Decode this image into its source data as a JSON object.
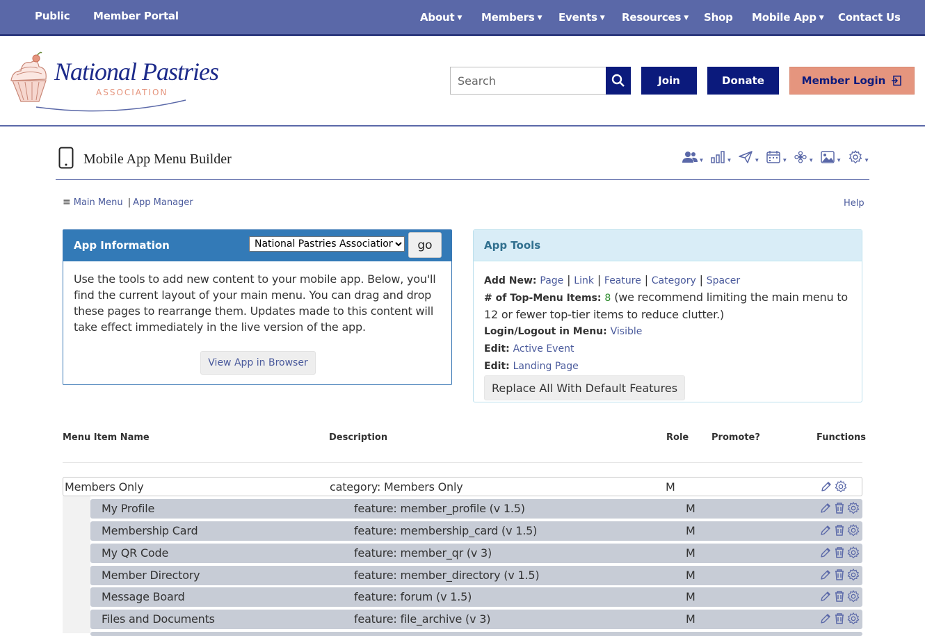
{
  "topnav": {
    "public": "Public",
    "member_portal": "Member Portal",
    "about": "About",
    "members": "Members",
    "events": "Events",
    "resources": "Resources",
    "shop": "Shop",
    "mobile_app": "Mobile App",
    "contact": "Contact Us"
  },
  "header": {
    "logo_line1": "National Pastries",
    "logo_line2": "ASSOCIATION",
    "search_placeholder": "Search",
    "join": "Join",
    "donate": "Donate",
    "login": "Member Login"
  },
  "page": {
    "title": "Mobile App Menu Builder",
    "breadcrumb_main": "Main Menu",
    "breadcrumb_sep": "|",
    "breadcrumb_app": "App Manager",
    "help": "Help"
  },
  "app_info": {
    "heading": "App Information",
    "selected_app": "National Pastries Association",
    "go": "go",
    "body": "Use the tools to add new content to your mobile app. Below, you'll find the current layout of your main menu. You can drag and drop these pages to rearrange them. Updates made to this content will take effect immediately in the live version of the app.",
    "view_button": "View App in Browser"
  },
  "app_tools": {
    "heading": "App Tools",
    "add_new_label": "Add New:",
    "add_links": [
      "Page",
      "Link",
      "Feature",
      "Category",
      "Spacer"
    ],
    "top_items_label": "# of Top-Menu Items:",
    "top_items_count": "8",
    "top_items_note": "(we recommend limiting the main menu to 12 or fewer top-tier items to reduce clutter.)",
    "login_label": "Login/Logout in Menu:",
    "login_value": "Visible",
    "edit_label": "Edit:",
    "edit_active_event": "Active Event",
    "edit_landing": "Landing Page",
    "replace_button": "Replace All With Default Features"
  },
  "table": {
    "headers": {
      "name": "Menu Item Name",
      "description": "Description",
      "role": "Role",
      "promote": "Promote?",
      "functions": "Functions"
    },
    "category": {
      "name": "Members Only",
      "description": "category: Members Only",
      "role": "M"
    },
    "rows": [
      {
        "name": "My Profile",
        "description": "feature: member_profile (v 1.5)",
        "role": "M"
      },
      {
        "name": "Membership Card",
        "description": "feature: membership_card (v 1.5)",
        "role": "M"
      },
      {
        "name": "My QR Code",
        "description": "feature: member_qr (v 3)",
        "role": "M"
      },
      {
        "name": "Member Directory",
        "description": "feature: member_directory (v 1.5)",
        "role": "M"
      },
      {
        "name": "Message Board",
        "description": "feature: forum (v 1.5)",
        "role": "M"
      },
      {
        "name": "Files and Documents",
        "description": "feature: file_archive (v 3)",
        "role": "M"
      }
    ]
  },
  "colors": {
    "nav_bg": "#5a68a8",
    "brand_navy": "#0b1a7c",
    "login_salmon": "#e5957e",
    "info_blue": "#337ab7",
    "row_gray": "#c7ccd6"
  },
  "icons": {
    "tool_icons": [
      "users-icon",
      "bar-chart-icon",
      "send-icon",
      "calendar-icon",
      "flower-icon",
      "image-icon",
      "gear-icon"
    ],
    "row_functions": [
      "pencil-icon",
      "trash-icon",
      "gear-icon"
    ]
  }
}
